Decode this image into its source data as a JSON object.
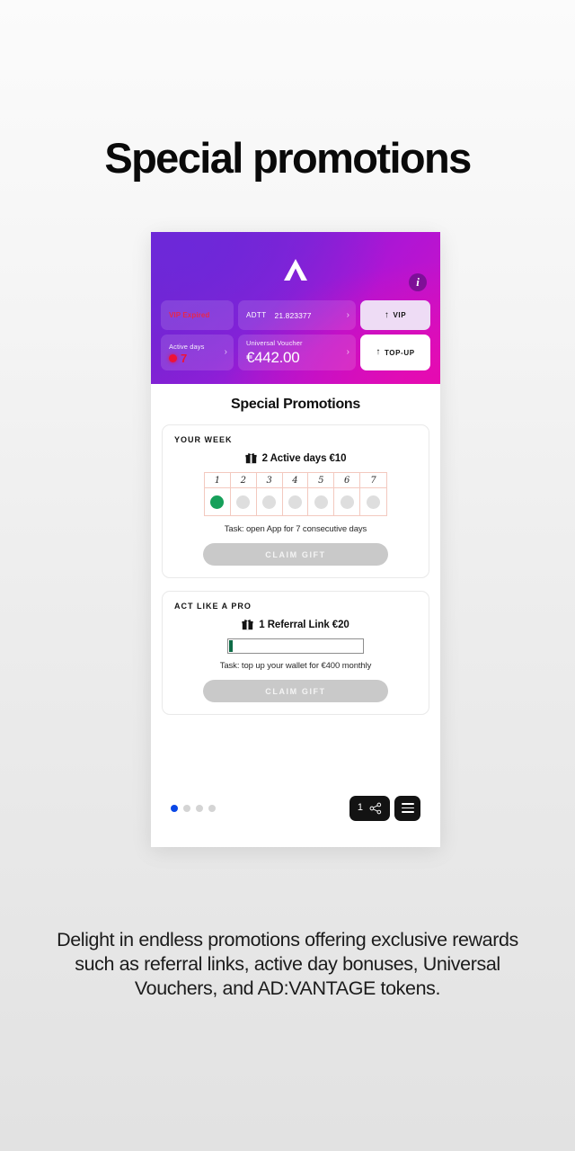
{
  "page": {
    "title": "Special promotions",
    "caption": "Delight in endless promotions offering exclusive rewards such as referral links, active day bonuses, Universal Vouchers, and AD:VANTAGE tokens."
  },
  "phone": {
    "header": {
      "logo_label": "advantage-logo",
      "info_label": "i",
      "vip_status": "VIP Expired",
      "active_days": {
        "label": "Active days",
        "value": "7"
      },
      "adtt": {
        "label": "ADTT",
        "value": "21.823377"
      },
      "voucher": {
        "label": "Universal Voucher",
        "value": "€442.00"
      },
      "buttons": {
        "vip": "VIP",
        "topup": "TOP-UP",
        "arrow": "↑"
      },
      "chevron": "›",
      "colors": {
        "gradient_start": "#6a27cf",
        "gradient_end": "#d411c4",
        "alert_red": "#ef1236"
      }
    },
    "content": {
      "section_title": "Special Promotions",
      "cards": [
        {
          "kicker": "YOUR WEEK",
          "reward": "2 Active days €10",
          "week_numbers": [
            "1",
            "2",
            "3",
            "4",
            "5",
            "6",
            "7"
          ],
          "week_filled": [
            true,
            false,
            false,
            false,
            false,
            false,
            false
          ],
          "task": "Task: open App for 7 consecutive days",
          "claim_label": "CLAIM GIFT"
        },
        {
          "kicker": "ACT LIKE A PRO",
          "reward": "1 Referral Link €20",
          "progress_percent": 3,
          "task": "Task: top up your wallet for €400 monthly",
          "claim_label": "CLAIM GIFT"
        }
      ]
    },
    "footer": {
      "page_dots": 4,
      "active_dot_index": 0,
      "share_count": "1",
      "share_icon": "share-icon",
      "menu_icon": "hamburger-menu-icon",
      "active_dot_color": "#0a47e6"
    }
  }
}
